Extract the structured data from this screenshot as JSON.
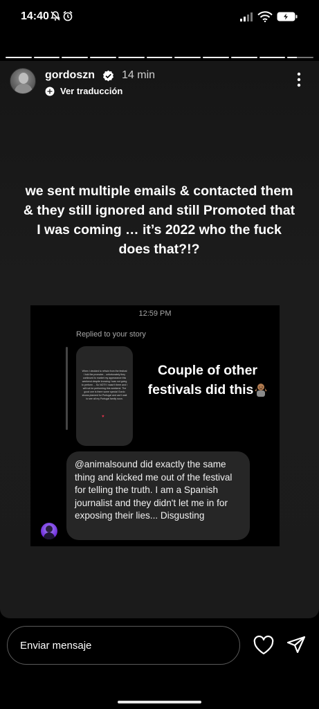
{
  "status_bar": {
    "time": "14:40",
    "battery_icon": "battery-icon",
    "signal_icon": "signal-icon",
    "wifi_icon": "wifi-icon"
  },
  "story": {
    "progress": {
      "segments": 11,
      "current_index": 10,
      "current_progress": 0.35
    },
    "header": {
      "username": "gordoszn",
      "verified": true,
      "time_ago": "14 min",
      "translate_label": "Ver traducción"
    },
    "headline": "we sent multiple emails & contacted them & they still ignored and still Promoted that I was coming … it’s 2022 who the fuck does that?!?",
    "screenshot": {
      "time": "12:59 PM",
      "replied_label": "Replied to your story",
      "story_thumb_text": "When I decided to refrain from the festival I told the promoter... unfortunately they continued to market my appearance this weekend despite knowing I was not going to perform ... So NOT!! I wasn’t there and I will not be performing this weekend. The good one is there some special Gordo shows planned for Portugal and can’t wait to see all my Portugal family soon.",
      "overlay_text": "Couple of other festivals did this",
      "overlay_emoji": "shrug-emoji",
      "message": "@animalsound did exactly the same thing and kicked me out of the festival for telling the truth. I am a Spanish journalist and they didn't let me in for exposing their lies... Disgusting"
    }
  },
  "footer": {
    "message_placeholder": "Enviar mensaje",
    "like_icon": "heart-icon",
    "send_icon": "send-icon"
  },
  "colors": {
    "background": "#000000",
    "story_background": "#1a1a1a",
    "bubble": "#262626",
    "text": "#ffffff",
    "muted": "#a8a8a8"
  }
}
